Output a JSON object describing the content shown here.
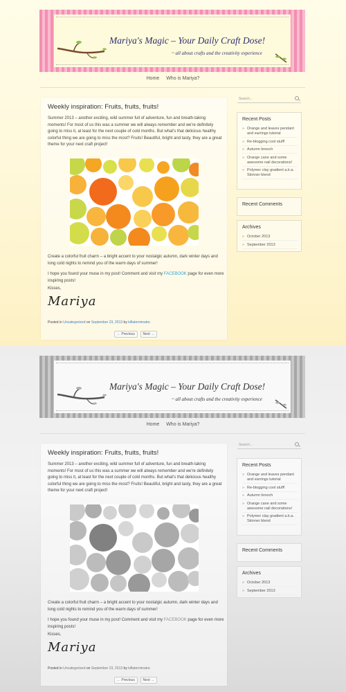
{
  "header": {
    "title": "Mariya's Magic – Your Daily Craft Dose!",
    "tagline": "~ all about crafts and the creativity experience"
  },
  "nav": {
    "items": [
      {
        "label": "Home"
      },
      {
        "label": "Who is Mariya?"
      }
    ]
  },
  "post": {
    "title": "Weekly inspiration: Fruits, fruits, fruits!",
    "intro": "Summer 2013 – another exciting, wild summer full of adventure, fun and breath-taking moments! For most of us this was a summer we will always remember and we're definitely going to miss it, at least for the next couple of cold months. But what's that delicious healthy colorful thing we are going to miss the most? Fruits! Beautiful, bright and tasty, they are a great theme for your next craft project!",
    "paragraph2": "Create a colorful fruit charm – a bright accent to your nostalgic autumn, dark winter days and long cold nights to remind you of the warm days of summer!",
    "paragraph3_before": "I hope you found your muse in my post! Comment and visit my ",
    "paragraph3_link": "FACEBOOK",
    "paragraph3_after": " page for even more inspiring posts!",
    "kisses": "Kisses,",
    "signature": "Mariya",
    "meta": {
      "posted_in": "Posted in",
      "category": "Uncategorized",
      "on": "on",
      "date": "September 23, 2013",
      "by": "by",
      "author": "kiflaterminator",
      "end": "."
    },
    "pager": {
      "previous": "← Previous",
      "next": "Next →"
    }
  },
  "sidebar": {
    "search_placeholder": "Search...",
    "recent_posts": {
      "title": "Recent Posts",
      "items": [
        "Orange and leaves pendant and earrings tutorial",
        "Re-blogging cool stuff!",
        "Autumn brooch",
        "Orange cane and some awesome nail decorations!",
        "Polymer clay gradient a.k.a. Skinner blend"
      ]
    },
    "recent_comments": {
      "title": "Recent Comments"
    },
    "archives": {
      "title": "Archives",
      "items": [
        "October 2013",
        "September 2013"
      ]
    }
  },
  "colors": {
    "banner_stripe": "#f48fb1",
    "banner_bg": "#fefbdc",
    "page_bg_top": "#fffce8",
    "page_bg_bottom": "#fdf1c4",
    "link": "#3a7fc4",
    "facebook_link": "#2aa7d8",
    "title_text": "#2e2e6e"
  }
}
